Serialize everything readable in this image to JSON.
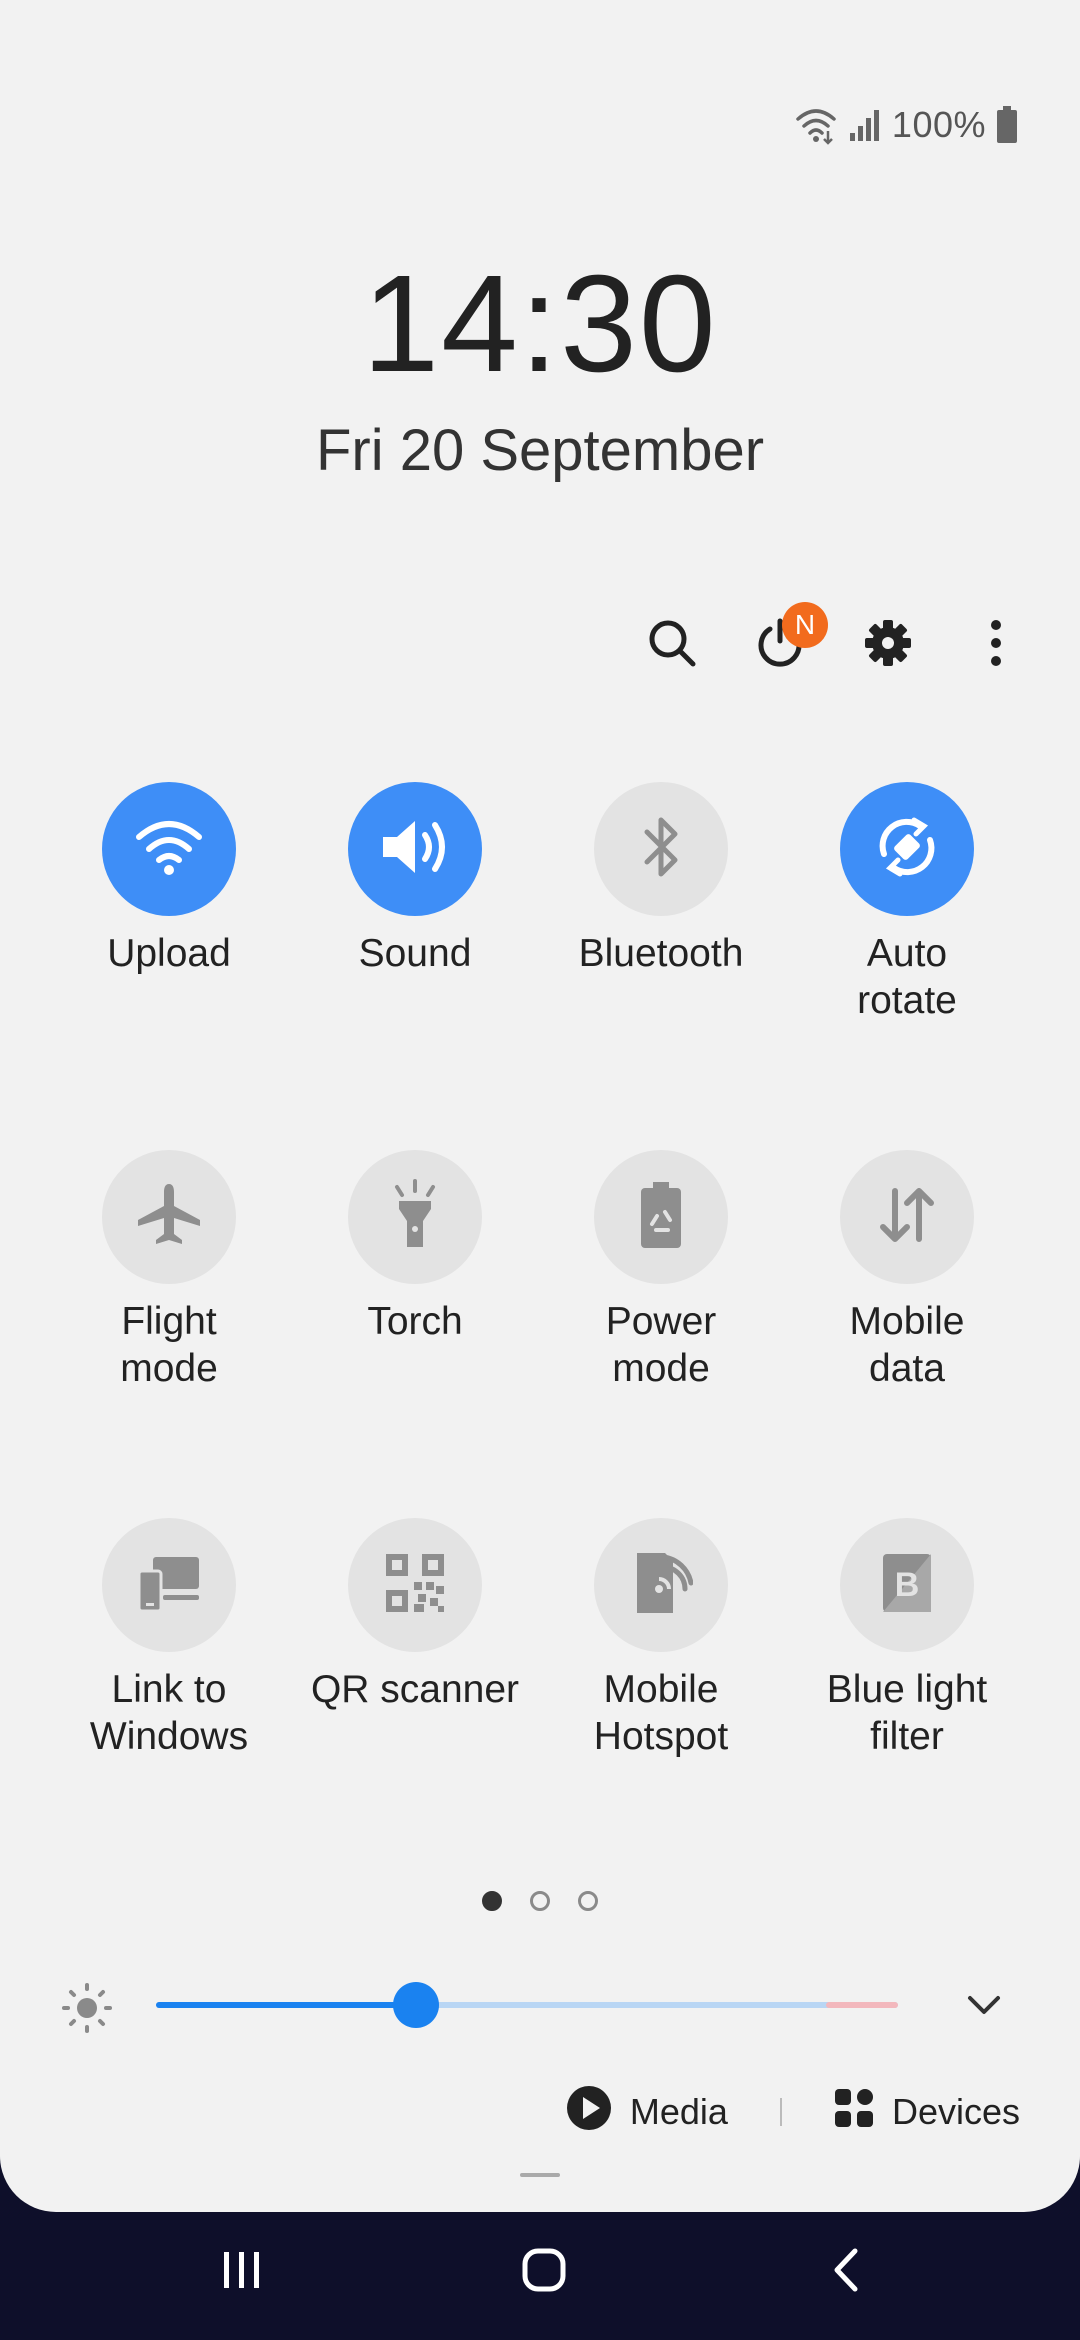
{
  "status_bar": {
    "battery_percent": "100%",
    "icons": [
      "wifi-icon",
      "signal-icon",
      "battery-icon"
    ]
  },
  "clock": {
    "time": "14:30",
    "date": "Fri 20 September"
  },
  "toolbar": {
    "icons": [
      "search-icon",
      "power-icon",
      "gear-icon",
      "more-icon"
    ],
    "notification_badge": "N"
  },
  "tiles": [
    {
      "label": "Upload",
      "icon": "wifi-icon",
      "active": true
    },
    {
      "label": "Sound",
      "icon": "speaker-icon",
      "active": true
    },
    {
      "label": "Bluetooth",
      "icon": "bluetooth-icon",
      "active": false
    },
    {
      "label": "Auto\nrotate",
      "icon": "rotate-icon",
      "active": true
    },
    {
      "label": "Flight\nmode",
      "icon": "airplane-icon",
      "active": false
    },
    {
      "label": "Torch",
      "icon": "torch-icon",
      "active": false
    },
    {
      "label": "Power\nmode",
      "icon": "battery-recycle-icon",
      "active": false
    },
    {
      "label": "Mobile\ndata",
      "icon": "data-arrows-icon",
      "active": false
    },
    {
      "label": "Link to\nWindows",
      "icon": "link-windows-icon",
      "active": false
    },
    {
      "label": "QR scanner",
      "icon": "qr-icon",
      "active": false
    },
    {
      "label": "Mobile\nHotspot",
      "icon": "hotspot-icon",
      "active": false
    },
    {
      "label": "Blue light\nfilter",
      "icon": "blue-light-icon",
      "active": false
    }
  ],
  "page_indicator": {
    "total": 3,
    "current": 1
  },
  "brightness": {
    "level": 0.35
  },
  "media": {
    "media_label": "Media",
    "devices_label": "Devices"
  },
  "colors": {
    "accent": "#3e8ef7",
    "panel": "#f2f2f2",
    "badge": "#f26b1d",
    "navbar": "#0e0f2a"
  }
}
